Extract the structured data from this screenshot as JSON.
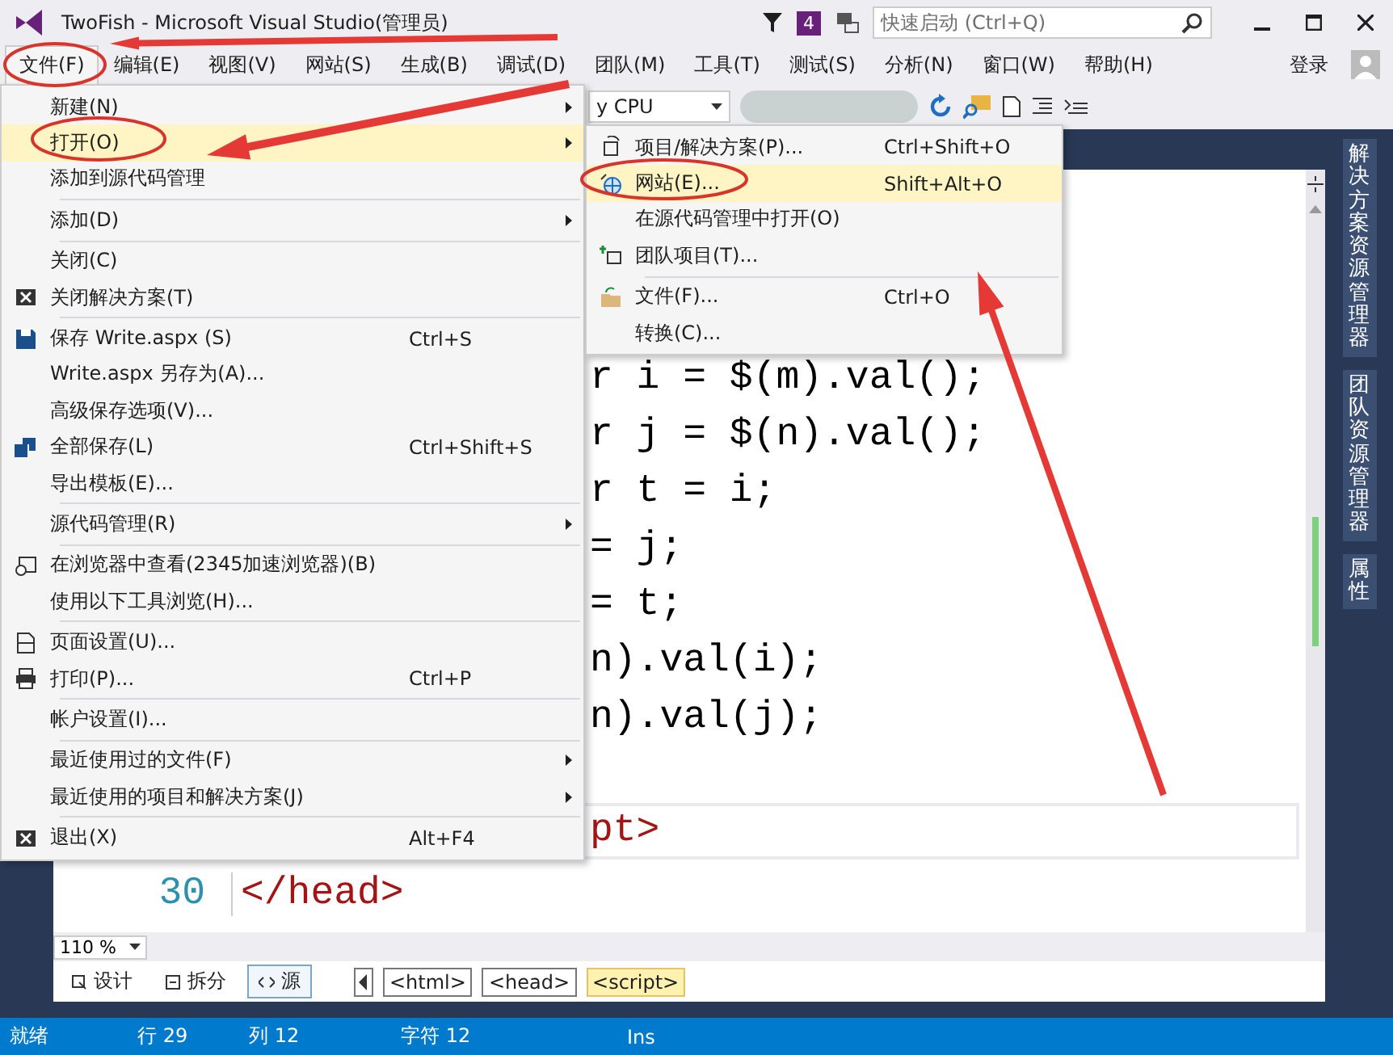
{
  "window": {
    "title": "TwoFish - Microsoft Visual Studio(管理员)",
    "notification_count": "4",
    "quick_launch": {
      "placeholder": "快速启动 (Ctrl+Q)"
    }
  },
  "menu_bar": {
    "items": [
      {
        "label": "文件(F)",
        "selected": true
      },
      {
        "label": "编辑(E)",
        "selected": false
      },
      {
        "label": "视图(V)",
        "selected": false
      },
      {
        "label": "网站(S)",
        "selected": false
      },
      {
        "label": "生成(B)",
        "selected": false
      },
      {
        "label": "调试(D)",
        "selected": false
      },
      {
        "label": "团队(M)",
        "selected": false
      },
      {
        "label": "工具(T)",
        "selected": false
      },
      {
        "label": "测试(S)",
        "selected": false
      },
      {
        "label": "分析(N)",
        "selected": false
      },
      {
        "label": "窗口(W)",
        "selected": false
      },
      {
        "label": "帮助(H)",
        "selected": false
      }
    ],
    "sign_in": "登录"
  },
  "toolbar": {
    "platform": "y CPU"
  },
  "file_menu": {
    "items": [
      {
        "kind": "item",
        "label": "新建(N)",
        "submenu": true,
        "selected": false
      },
      {
        "kind": "item",
        "label": "打开(O)",
        "submenu": true,
        "selected": true
      },
      {
        "kind": "item",
        "label": "添加到源代码管理",
        "submenu": false,
        "selected": false
      },
      {
        "kind": "separator"
      },
      {
        "kind": "item",
        "label": "添加(D)",
        "submenu": true,
        "selected": false
      },
      {
        "kind": "separator"
      },
      {
        "kind": "item",
        "label": "关闭(C)",
        "submenu": false,
        "selected": false
      },
      {
        "kind": "item",
        "label": "关闭解决方案(T)",
        "submenu": false,
        "selected": false
      },
      {
        "kind": "separator"
      },
      {
        "kind": "item",
        "label": "保存 Write.aspx (S)",
        "shortcut": "Ctrl+S",
        "submenu": false,
        "selected": false
      },
      {
        "kind": "item",
        "label": "Write.aspx 另存为(A)...",
        "submenu": false,
        "selected": false
      },
      {
        "kind": "item",
        "label": "高级保存选项(V)...",
        "submenu": false,
        "selected": false
      },
      {
        "kind": "item",
        "label": "全部保存(L)",
        "shortcut": "Ctrl+Shift+S",
        "submenu": false,
        "selected": false
      },
      {
        "kind": "item",
        "label": "导出模板(E)...",
        "submenu": false,
        "selected": false
      },
      {
        "kind": "separator"
      },
      {
        "kind": "item",
        "label": "源代码管理(R)",
        "submenu": true,
        "selected": false
      },
      {
        "kind": "separator"
      },
      {
        "kind": "item",
        "label": "在浏览器中查看(2345加速浏览器)(B)",
        "submenu": false,
        "selected": false
      },
      {
        "kind": "item",
        "label": "使用以下工具浏览(H)...",
        "submenu": false,
        "selected": false
      },
      {
        "kind": "separator"
      },
      {
        "kind": "item",
        "label": "页面设置(U)...",
        "submenu": false,
        "selected": false
      },
      {
        "kind": "item",
        "label": "打印(P)...",
        "shortcut": "Ctrl+P",
        "submenu": false,
        "selected": false
      },
      {
        "kind": "separator"
      },
      {
        "kind": "item",
        "label": "帐户设置(I)...",
        "submenu": false,
        "selected": false
      },
      {
        "kind": "separator"
      },
      {
        "kind": "item",
        "label": "最近使用过的文件(F)",
        "submenu": true,
        "selected": false
      },
      {
        "kind": "item",
        "label": "最近使用的项目和解决方案(J)",
        "submenu": true,
        "selected": false
      },
      {
        "kind": "separator"
      },
      {
        "kind": "item",
        "label": "退出(X)",
        "shortcut": "Alt+F4",
        "submenu": false,
        "selected": false
      }
    ]
  },
  "open_submenu": {
    "items": [
      {
        "kind": "item",
        "label": "项目/解决方案(P)...",
        "shortcut": "Ctrl+Shift+O",
        "selected": false
      },
      {
        "kind": "item",
        "label": "网站(E)...",
        "shortcut": "Shift+Alt+O",
        "selected": true
      },
      {
        "kind": "item",
        "label": "在源代码管理中打开(O)",
        "selected": false
      },
      {
        "kind": "item",
        "label": "团队项目(T)...",
        "selected": false
      },
      {
        "kind": "separator"
      },
      {
        "kind": "item",
        "label": "文件(F)...",
        "shortcut": "Ctrl+O",
        "selected": false
      },
      {
        "kind": "item",
        "label": "转换(C)...",
        "selected": false
      }
    ]
  },
  "editor": {
    "lines": [
      {
        "kind": "script",
        "text": "r i = $(m).val();"
      },
      {
        "kind": "script",
        "text": "r j = $(n).val();"
      },
      {
        "kind": "script",
        "text": "r t = i;"
      },
      {
        "kind": "script",
        "text": "= j;"
      },
      {
        "kind": "script",
        "text": "= t;"
      },
      {
        "kind": "script",
        "text": "n).val(i);"
      },
      {
        "kind": "script",
        "text": "n).val(j);"
      },
      {
        "kind": "blank"
      },
      {
        "kind": "markup",
        "text": "pt>",
        "current": true
      },
      {
        "kind": "markup",
        "number": "30",
        "text": "</head>",
        "current": false
      }
    ],
    "zoom": "110 %"
  },
  "side_tabs": [
    "解决方案资源管理器",
    "团队资源管理器",
    "属性"
  ],
  "view_tabs": [
    {
      "label": "设计",
      "selected": false
    },
    {
      "label": "拆分",
      "selected": false
    },
    {
      "label": "源",
      "selected": true
    }
  ],
  "breadcrumbs": [
    {
      "label": "<html>",
      "selected": false
    },
    {
      "label": "<head>",
      "selected": false
    },
    {
      "label": "<script>",
      "selected": true
    }
  ],
  "status_bar": {
    "state": "就绪",
    "line": "行 29",
    "column": "列 12",
    "character": "字符 12",
    "mode": "Ins"
  }
}
